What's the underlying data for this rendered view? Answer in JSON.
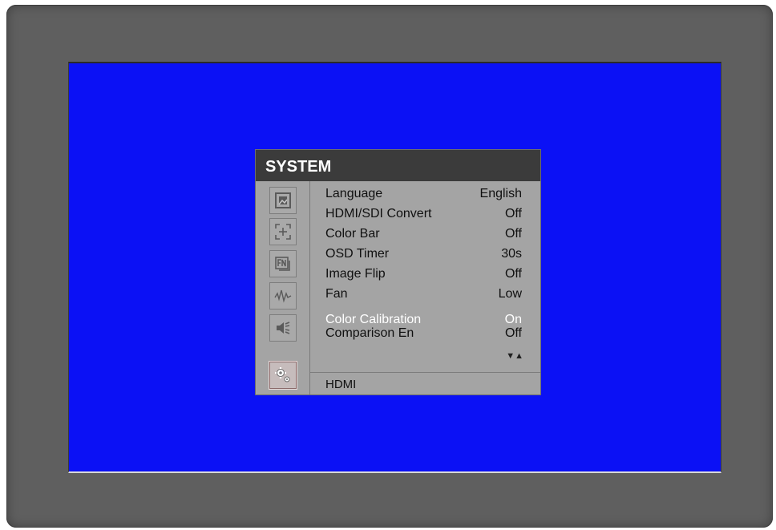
{
  "osd": {
    "title": "SYSTEM",
    "nav_icons": [
      "picture-icon",
      "marker-icon",
      "function-icon",
      "waveform-icon",
      "audio-icon",
      "system-gear-icon"
    ],
    "active_nav": "system-gear-icon",
    "items": [
      {
        "label": "Language",
        "value": "English"
      },
      {
        "label": "HDMI/SDI Convert",
        "value": "Off"
      },
      {
        "label": "Color Bar",
        "value": "Off"
      },
      {
        "label": "OSD Timer",
        "value": "30s"
      },
      {
        "label": "Image Flip",
        "value": "Off"
      },
      {
        "label": "Fan",
        "value": "Low"
      },
      {
        "label": "Color Calibration",
        "value": "On"
      },
      {
        "label": "Comparison En",
        "value": "Off"
      }
    ],
    "scroll_arrows": "▼▲",
    "footer": "HDMI"
  },
  "colors": {
    "screen_background": "#0b11f5",
    "bezel": "#5f5f5f",
    "osd_background": "#a4a4a4",
    "osd_title_bar": "#3b3b3b",
    "highlight_text": "#ffffff"
  }
}
